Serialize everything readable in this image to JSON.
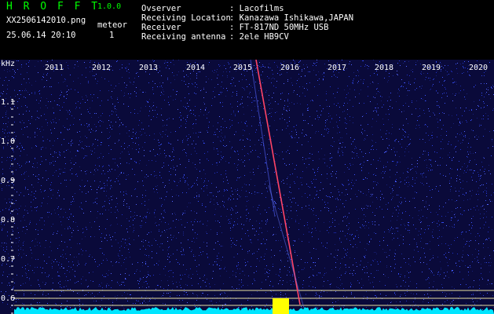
{
  "app": {
    "title": "H R O F F T",
    "version": "1.0.0"
  },
  "file": {
    "name": "XX2506142010.png",
    "datetime": "25.06.14 20:10"
  },
  "meteor": {
    "label": "meteor",
    "count": "1"
  },
  "info": [
    {
      "label": "Ovserver",
      "value": ": Lacofilms"
    },
    {
      "label": "Receiving Location",
      "value": ": Kanazawa Ishikawa,JAPAN"
    },
    {
      "label": "Receiver",
      "value": ": FT-817ND 50MHz USB"
    },
    {
      "label": "Receiving antenna",
      "value": ": 2ele HB9CV"
    }
  ],
  "spectrogram": {
    "y_unit": "kHz",
    "y_ticks": [
      "1.1",
      "1.0",
      "0.9",
      "0.8",
      "0.7",
      "0.6"
    ],
    "top_labels": [
      "2011",
      "2012",
      "2013",
      "2014",
      "2015",
      "2016",
      "2017",
      "2018",
      "2019",
      "2020"
    ],
    "colors": {
      "background": "#0a0a3a",
      "noise": "#2233cc",
      "trace": "#ff4466",
      "baseline": "#00e5ff",
      "marker": "#ffff00",
      "guide": "#e8e0a0"
    }
  }
}
